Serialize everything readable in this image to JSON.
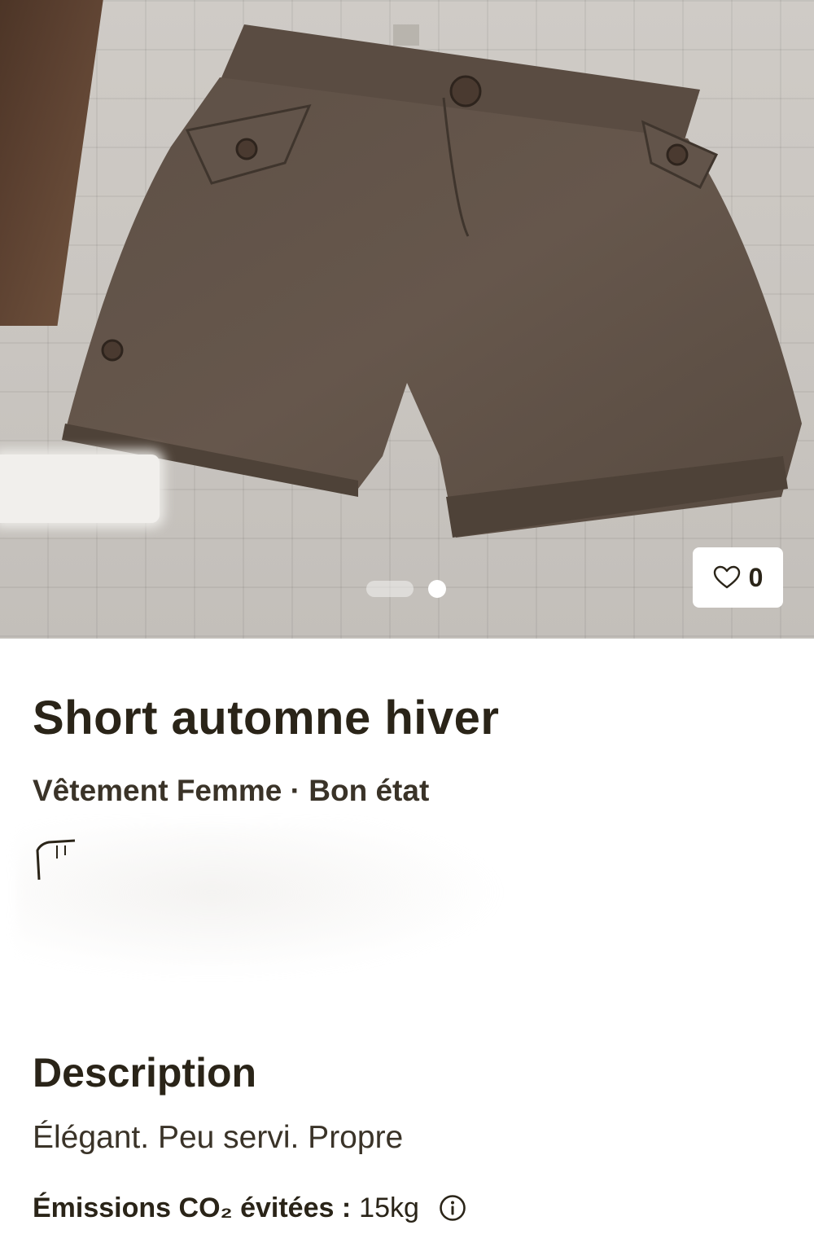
{
  "gallery": {
    "image_description_icon": "shorts-photo",
    "current_index": 2,
    "total_images": 2,
    "like_count": "0"
  },
  "product": {
    "title": "Short automne hiver",
    "subtitle": "Vêtement Femme · Bon état"
  },
  "description": {
    "heading": "Description",
    "text": "Élégant. Peu servi. Propre"
  },
  "co2": {
    "label": "Émissions CO₂ évitées :",
    "value": "15kg"
  },
  "colors": {
    "text": "#2a2418",
    "background": "#ffffff"
  }
}
